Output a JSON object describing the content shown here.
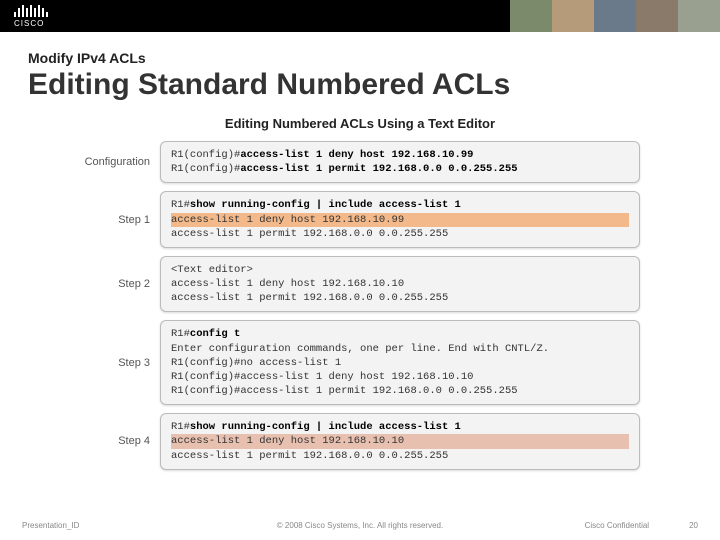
{
  "header": {
    "logo_text": "CISCO"
  },
  "suptitle": "Modify IPv4 ACLs",
  "title": "Editing Standard Numbered ACLs",
  "panel_title": "Editing Numbered ACLs Using a Text Editor",
  "config": {
    "label": "Configuration",
    "line1_prompt": "R1(config)#",
    "line1_cmd": "access-list 1 deny host 192.168.10.99",
    "line2_prompt": "R1(config)#",
    "line2_cmd": "access-list 1 permit 192.168.0.0 0.0.255.255"
  },
  "step1": {
    "label": "Step 1",
    "prompt": "R1#",
    "cmd": "show running-config | include access-list 1",
    "out1": "access-list 1 deny host 192.168.10.99",
    "out2": "access-list 1 permit 192.168.0.0 0.0.255.255"
  },
  "step2": {
    "label": "Step 2",
    "head": "<Text editor>",
    "out1": "access-list 1 deny host 192.168.10.10",
    "out2": "access-list 1 permit 192.168.0.0 0.0.255.255"
  },
  "step3": {
    "label": "Step 3",
    "prompt": "R1#",
    "cmd": "config t",
    "msg": "Enter configuration commands, one per line.  End with CNTL/Z.",
    "l1_prompt": "R1(config)#",
    "l1_cmd": "no access-list 1",
    "l2_prompt": "R1(config)#",
    "l2_cmd": "access-list 1 deny host 192.168.10.10",
    "l3_prompt": "R1(config)#",
    "l3_cmd": "access-list 1 permit 192.168.0.0 0.0.255.255"
  },
  "step4": {
    "label": "Step 4",
    "prompt": "R1#",
    "cmd": "show running-config | include access-list 1",
    "out1": "access-list 1 deny host 192.168.10.10",
    "out2": "access-list 1 permit 192.168.0.0 0.0.255.255"
  },
  "footer": {
    "left": "Presentation_ID",
    "mid": "© 2008 Cisco Systems, Inc. All rights reserved.",
    "conf": "Cisco Confidential",
    "page": "20"
  }
}
